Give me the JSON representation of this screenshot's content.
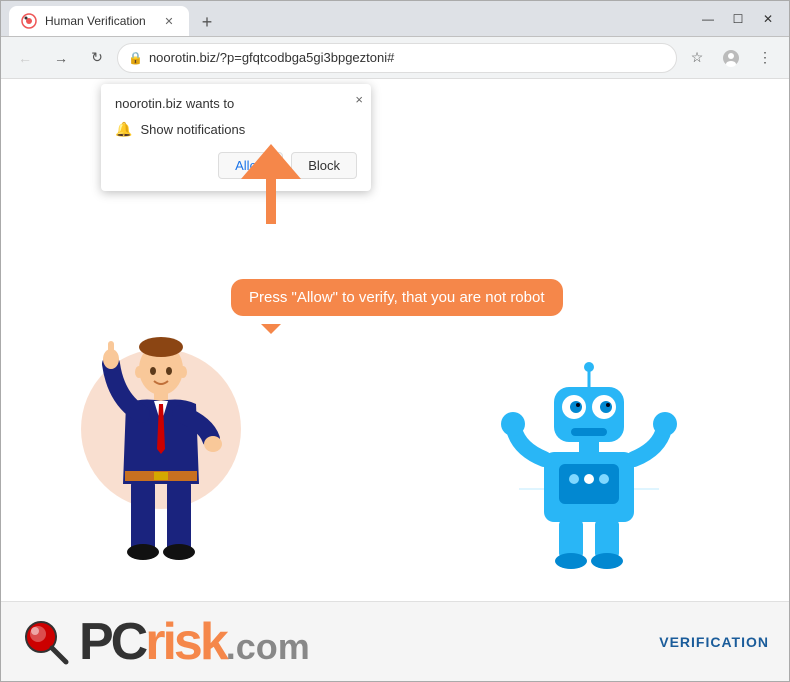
{
  "window": {
    "title": "Human Verification",
    "tab_label": "Human Verification",
    "controls": {
      "minimize": "—",
      "maximize": "☐",
      "close": "✕"
    }
  },
  "toolbar": {
    "back_label": "←",
    "forward_label": "→",
    "refresh_label": "↻",
    "address": "noorotin.biz/?p=gfqtcodbga5gi3bpgeztoni#",
    "star_label": "☆",
    "new_tab_label": "+"
  },
  "notification_popup": {
    "title": "noorotin.biz wants to",
    "notification_text": "Show notifications",
    "allow_label": "Allow",
    "block_label": "Block",
    "close_label": "×"
  },
  "page": {
    "speech_bubble_text": "Press \"Allow\" to verify, that you are not robot",
    "footer_logo": "PC",
    "footer_risk": "risk",
    "footer_com": ".com",
    "verification_label": "VERIFICATION"
  }
}
